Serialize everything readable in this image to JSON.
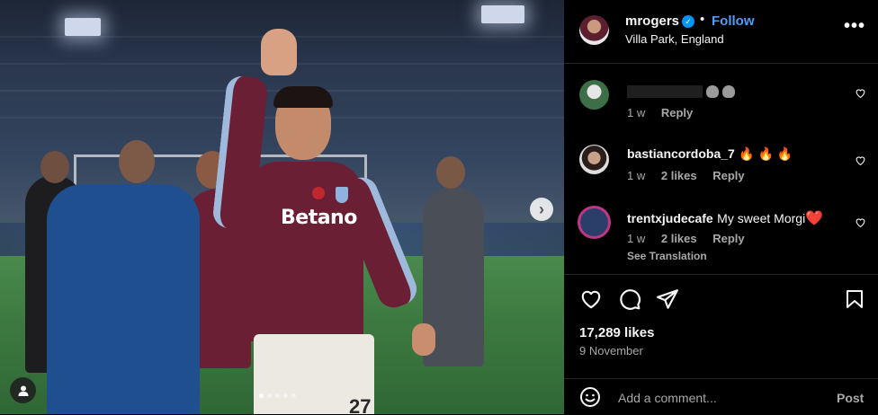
{
  "post": {
    "photo": {
      "shirt_sponsor": "Betano",
      "shirt_number": "27",
      "carousel_dots": 5,
      "active_dot": 0,
      "next_icon": "chevron-right-icon",
      "tag_icon": "user-icon"
    },
    "header": {
      "username": "mrogers",
      "verified_icon": "verified-badge-icon",
      "separator": "•",
      "follow_label": "Follow",
      "location": "Villa Park, England",
      "more_icon": "more-horizontal-icon"
    },
    "comments": [
      {
        "username": "",
        "text": "",
        "time": "1 w",
        "likes": "",
        "reply_label": "Reply",
        "translation": ""
      },
      {
        "username": "bastiancordoba_7",
        "text": "🔥 🔥 🔥",
        "time": "1 w",
        "likes": "2 likes",
        "reply_label": "Reply",
        "translation": ""
      },
      {
        "username": "trentxjudecafe",
        "text": "My sweet Morgi",
        "text_suffix": "❤️",
        "time": "1 w",
        "likes": "2 likes",
        "reply_label": "Reply",
        "translation": "See Translation"
      }
    ],
    "actions": {
      "like_icon": "heart-icon",
      "comment_icon": "comment-icon",
      "share_icon": "share-icon",
      "save_icon": "bookmark-icon"
    },
    "likes": "17,289 likes",
    "date": "9 November",
    "add_comment": {
      "emoji_icon": "emoji-icon",
      "placeholder": "Add a comment...",
      "post_label": "Post"
    }
  },
  "colors": {
    "accent_blue": "#4f9cf9",
    "verified_blue": "#0095f6",
    "muted_text": "#a8a8a8",
    "shirt_claret": "#6b1f34"
  }
}
